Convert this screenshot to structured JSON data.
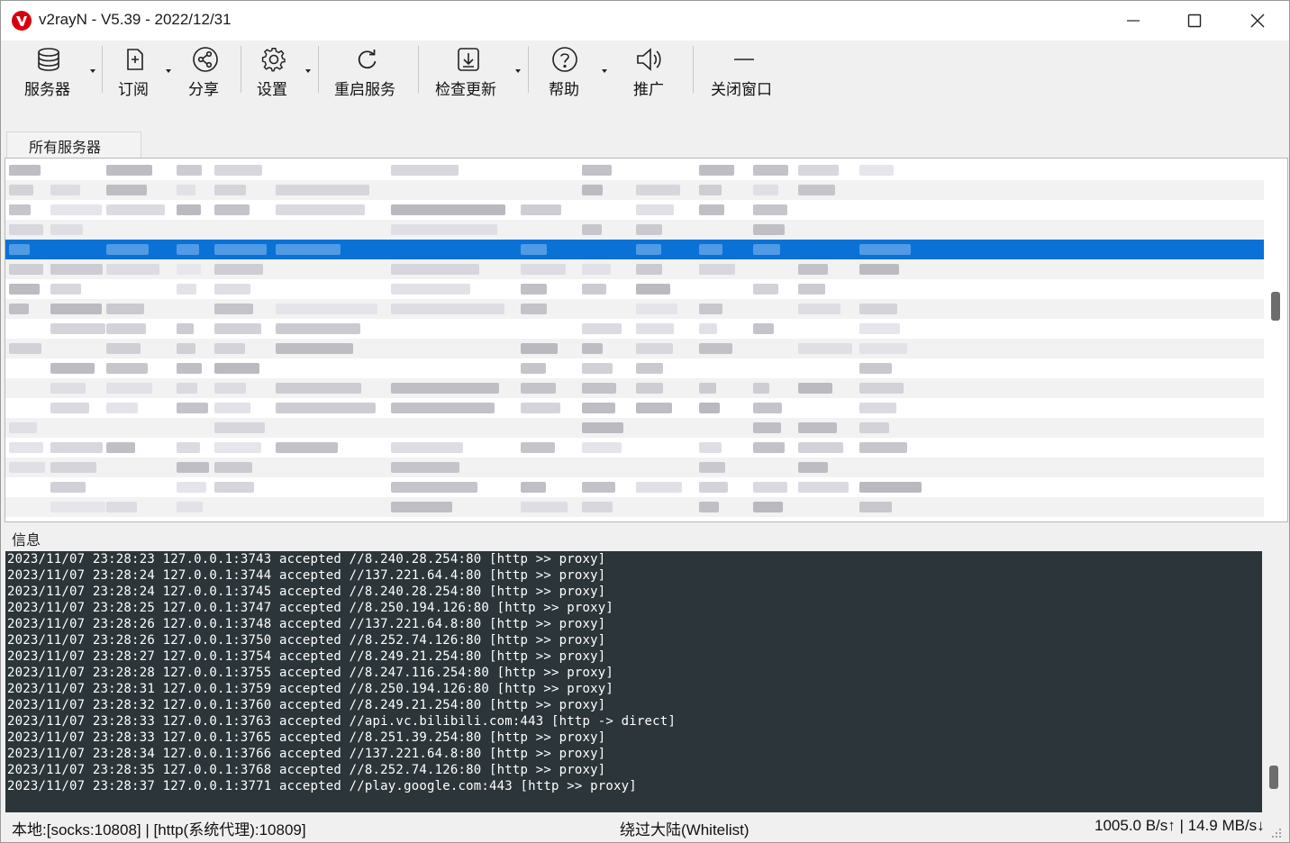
{
  "window": {
    "title": "v2rayN - V5.39 - 2022/12/31",
    "controls": [
      "minimize-icon",
      "maximize-icon",
      "close-icon"
    ]
  },
  "toolbar": {
    "items": [
      {
        "label": "服务器",
        "icon": "database-icon",
        "has_dropdown": true
      },
      {
        "label": "订阅",
        "icon": "subscribe-icon",
        "has_dropdown": true
      },
      {
        "label": "分享",
        "icon": "share-icon",
        "has_dropdown": false
      },
      {
        "label": "设置",
        "icon": "gear-icon",
        "has_dropdown": true
      },
      {
        "label": "重启服务",
        "icon": "refresh-icon",
        "has_dropdown": false
      },
      {
        "label": "检查更新",
        "icon": "download-icon",
        "has_dropdown": true
      },
      {
        "label": "帮助",
        "icon": "help-icon",
        "has_dropdown": true
      },
      {
        "label": "推广",
        "icon": "speaker-icon",
        "has_dropdown": false
      },
      {
        "label": "关闭窗口",
        "icon": "minus-icon",
        "has_dropdown": false
      }
    ]
  },
  "tabs": [
    {
      "label": "所有服务器",
      "active": true
    }
  ],
  "server_list": {
    "note_visible": false
  },
  "info": {
    "label": "信息",
    "log_lines": [
      "2023/11/07 23:28:23 127.0.0.1:3743 accepted //8.240.28.254:80 [http >> proxy]",
      "2023/11/07 23:28:24 127.0.0.1:3744 accepted //137.221.64.4:80 [http >> proxy]",
      "2023/11/07 23:28:24 127.0.0.1:3745 accepted //8.240.28.254:80 [http >> proxy]",
      "2023/11/07 23:28:25 127.0.0.1:3747 accepted //8.250.194.126:80 [http >> proxy]",
      "2023/11/07 23:28:26 127.0.0.1:3748 accepted //137.221.64.8:80 [http >> proxy]",
      "2023/11/07 23:28:26 127.0.0.1:3750 accepted //8.252.74.126:80 [http >> proxy]",
      "2023/11/07 23:28:27 127.0.0.1:3754 accepted //8.249.21.254:80 [http >> proxy]",
      "2023/11/07 23:28:28 127.0.0.1:3755 accepted //8.247.116.254:80 [http >> proxy]",
      "2023/11/07 23:28:31 127.0.0.1:3759 accepted //8.250.194.126:80 [http >> proxy]",
      "2023/11/07 23:28:32 127.0.0.1:3760 accepted //8.249.21.254:80 [http >> proxy]",
      "2023/11/07 23:28:33 127.0.0.1:3763 accepted //api.vc.bilibili.com:443 [http -> direct]",
      "2023/11/07 23:28:33 127.0.0.1:3765 accepted //8.251.39.254:80 [http >> proxy]",
      "2023/11/07 23:28:34 127.0.0.1:3766 accepted //137.221.64.8:80 [http >> proxy]",
      "2023/11/07 23:28:35 127.0.0.1:3768 accepted //8.252.74.126:80 [http >> proxy]",
      "2023/11/07 23:28:37 127.0.0.1:3771 accepted //play.google.com:443 [http >> proxy]"
    ]
  },
  "status": {
    "left": "本地:[socks:10808] | [http(系统代理):10809]",
    "center": "绕过大陆(Whitelist)",
    "right": "1005.0 B/s↑ | 14.9 MB/s↓"
  },
  "colors": {
    "selection": "#0a72d6",
    "console_bg": "#2c3539",
    "logo_red": "#d7000f"
  }
}
